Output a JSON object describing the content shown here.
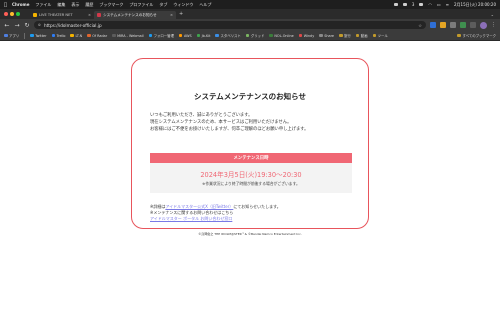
{
  "menubar": {
    "apple": "",
    "app": "Chrome",
    "items": [
      "ファイル",
      "編集",
      "表示",
      "履歴",
      "ブックマーク",
      "プロファイル",
      "タブ",
      "ウィンドウ",
      "ヘルプ"
    ],
    "status": {
      "a": "3",
      "b": "••",
      "date": "2月15日(火) 20:00:20"
    }
  },
  "tabs": [
    {
      "label": "LIVE THEATER NET",
      "color": "#f5b400",
      "active": false
    },
    {
      "label": "システムメンテナンスのお知らせ",
      "color": "#d2394a",
      "active": true
    }
  ],
  "toolbar": {
    "url": "https://idolmaster-official.jp",
    "back": "←",
    "forward": "→",
    "reload": "↻"
  },
  "bookmarks": [
    {
      "label": "アプリ",
      "color": "#4f7fe0"
    },
    {
      "label": "Twitter",
      "color": "#1d9bf0"
    },
    {
      "label": "Trello",
      "color": "#2d7cf6"
    },
    {
      "label": "LT.N",
      "color": "#f5b400"
    },
    {
      "label": "Of Radar",
      "color": "#e0662e"
    },
    {
      "label": "MIRA - Webmail",
      "color": "#5c5c5c"
    },
    {
      "label": "フォロー管理",
      "color": "#1d9bf0"
    },
    {
      "label": "AWS",
      "color": "#ff9900"
    },
    {
      "label": "Jb-Kit",
      "color": "#3fa34d"
    },
    {
      "label": "スタベリスト",
      "color": "#3a8ee6"
    },
    {
      "label": "グリッド",
      "color": "#7bb661"
    },
    {
      "label": "NOL-Online",
      "color": "#3b7d3b"
    },
    {
      "label": "Windy",
      "color": "#e04848"
    },
    {
      "label": "Share",
      "color": "#8a8a8a"
    },
    {
      "label": "旅行",
      "color": "#c29a2b"
    },
    {
      "label": "動画",
      "color": "#c29a2b"
    },
    {
      "label": "ツール",
      "color": "#c29a2b"
    }
  ],
  "bookmarks_all": "すべてのブックマーク",
  "notice": {
    "title": "システムメンテナンスのお知らせ",
    "body": [
      "いつもご利用いただき、誠にありがとうございます。",
      "現在システムメンテナンスのため、本サービスはご利用いただけません。",
      "お客様にはご不便をお掛けいたしますが、何卒ご理解のほどお願い申し上げます。"
    ],
    "maint_label": "メンテナンス日時",
    "maint_date": "2024年3月5日(火)19:30～20:30",
    "maint_note": "※作業状況により終了時間が前後する場合がございます。",
    "foot_prefix": "※詳細は",
    "foot_link1": "アイドルマスター公式X（旧Twitter）",
    "foot_suffix": "にてお知らせいたします。",
    "foot_line2": "※メンテナンスに関するお問い合わせはこちら",
    "foot_link2": "アイドルマスター ポータル お問い合わせ窓口"
  },
  "copyright": "©窪岡俊之 THE IDOLM@STER™& ©Bandai Namco Entertainment Inc."
}
